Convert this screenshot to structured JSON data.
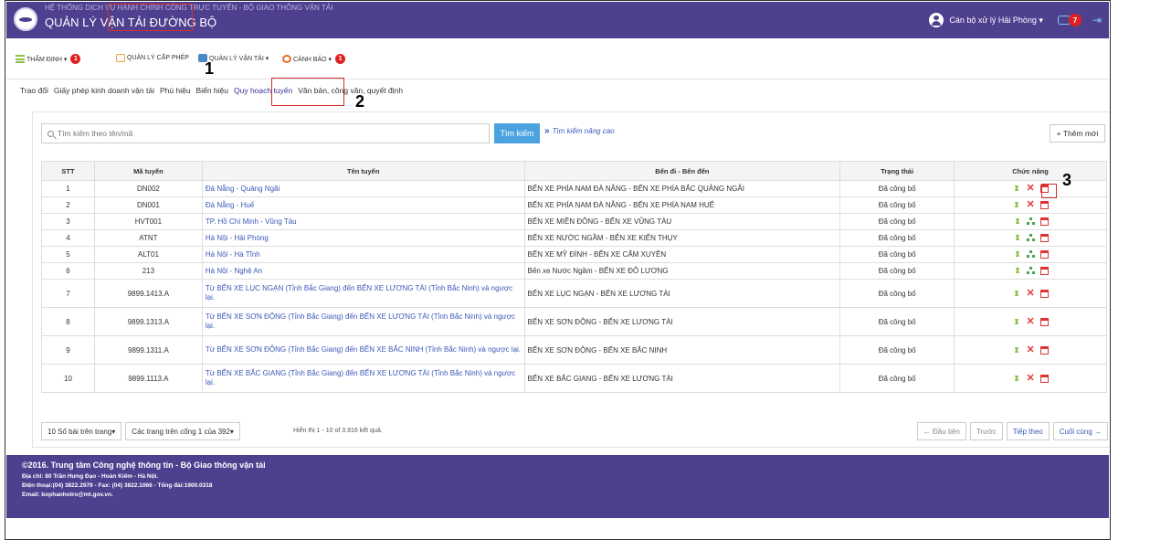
{
  "header": {
    "subtitle": "HỆ THỐNG DỊCH VỤ HÀNH CHÍNH CÔNG TRỰC TUYẾN - BỘ GIAO THÔNG VẬN TẢI",
    "title": "QUẢN LÝ VẬN TẢI ĐƯỜNG BỘ",
    "user": "Cán bộ xử lý Hải Phòng ▾",
    "notif_count": "7"
  },
  "menu": [
    {
      "label": "THẨM ĐỊNH ▾",
      "badge": "1"
    },
    {
      "label": "QUẢN LÝ CẤP PHÉP"
    },
    {
      "label": "QUẢN LÝ VẬN TẢI ▾"
    },
    {
      "label": "CẢNH BÁO ▾",
      "badge": "1"
    }
  ],
  "submenu": [
    "Trao đổi",
    "Giấy phép kinh doanh vận tải",
    "Phù hiệu",
    "Biển hiệu",
    "Quy hoạch tuyến",
    "Văn bản, công văn, quyết định"
  ],
  "annotations": [
    "1",
    "2",
    "3"
  ],
  "search": {
    "placeholder": "Tìm kiếm theo tên/mã",
    "button": "Tìm kiếm",
    "advanced": "Tìm kiếm nâng cao",
    "add_button": "+ Thêm mới"
  },
  "table": {
    "headers": [
      "STT",
      "Mã tuyến",
      "Tên tuyến",
      "Bến đi - Bến đến",
      "Trạng thái",
      "Chức năng"
    ],
    "rows": [
      {
        "stt": "1",
        "code": "DN002",
        "name": "Đà Nẵng - Quảng Ngãi",
        "stations": "BẾN XE PHÍA NAM ĐÀ NẴNG - BẾN XE PHÍA BẮC QUẢNG NGÃI",
        "status": "Đã công bố",
        "actions": [
          "approve",
          "delete",
          "calendar"
        ]
      },
      {
        "stt": "2",
        "code": "DN001",
        "name": "Đà Nẵng - Huế",
        "stations": "BẾN XE PHÍA NAM ĐÀ NẴNG - BẾN XE PHÍA NAM HUẾ",
        "status": "Đã công bố",
        "actions": [
          "approve",
          "delete",
          "calendar"
        ]
      },
      {
        "stt": "3",
        "code": "HVT001",
        "name": "TP. Hồ Chí Minh - Vũng Tàu",
        "stations": "BẾN XE MIỀN ĐÔNG - BẾN XE VŨNG TÀU",
        "status": "Đã công bố",
        "actions": [
          "approve",
          "tree",
          "calendar"
        ]
      },
      {
        "stt": "4",
        "code": "ATNT",
        "name": "Hà Nội - Hải Phòng",
        "stations": "BẾN XE NƯỚC NGẦM - BẾN XE KIẾN THỤY",
        "status": "Đã công bố",
        "actions": [
          "approve",
          "tree",
          "calendar"
        ]
      },
      {
        "stt": "5",
        "code": "ALT01",
        "name": "Hà Nội - Hà Tĩnh",
        "stations": "BẾN XE MỸ ĐÌNH - BẾN XE CẨM XUYÊN",
        "status": "Đã công bố",
        "actions": [
          "approve",
          "tree",
          "calendar"
        ]
      },
      {
        "stt": "6",
        "code": "213",
        "name": "Hà Nội - Nghệ An",
        "stations": "Bến xe Nước Ngầm - BẾN XE ĐÔ LƯƠNG",
        "status": "Đã công bố",
        "actions": [
          "approve",
          "tree",
          "calendar"
        ]
      },
      {
        "stt": "7",
        "code": "9899.1413.A",
        "name": "Từ BẾN XE LỤC NGẠN (Tỉnh Bắc Giang) đến BẾN XE LƯƠNG TÀI (Tỉnh Bắc Ninh) và ngược lại.",
        "stations": "BẾN XE LỤC NGẠN - BẾN XE LƯƠNG TÀI",
        "status": "Đã công bố",
        "actions": [
          "approve",
          "delete",
          "calendar"
        ]
      },
      {
        "stt": "8",
        "code": "9899.1313.A",
        "name": "Từ BẾN XE SƠN ĐỘNG (Tỉnh Bắc Giang) đến BẾN XE LƯƠNG TÀI (Tỉnh Bắc Ninh) và ngược lại.",
        "stations": "BẾN XE SƠN ĐỘNG - BẾN XE LƯƠNG TÀI",
        "status": "Đã công bố",
        "actions": [
          "approve",
          "delete",
          "calendar"
        ]
      },
      {
        "stt": "9",
        "code": "9899.1311.A",
        "name": "Từ BẾN XE SƠN ĐỘNG (Tỉnh Bắc Giang) đến BẾN XE BẮC NINH (Tỉnh Bắc Ninh) và ngược lại.",
        "stations": "BẾN XE SƠN ĐỘNG - BẾN XE BẮC NINH",
        "status": "Đã công bố",
        "actions": [
          "approve",
          "delete",
          "calendar"
        ]
      },
      {
        "stt": "10",
        "code": "9899.1113.A",
        "name": "Từ BẾN XE BẮC GIANG (Tỉnh Bắc Giang) đến BẾN XE LƯƠNG TÀI (Tỉnh Bắc Ninh) và ngược lại.",
        "stations": "BẾN XE BẮC GIANG - BẾN XE LƯƠNG TÀI",
        "status": "Đã công bố",
        "actions": [
          "approve",
          "delete",
          "calendar"
        ]
      }
    ]
  },
  "pagination": {
    "per_page": "10 Số bài trên trang▾",
    "pages": "Các trang trên cổng 1 của 392▾",
    "info": "Hiển thị 1 - 10 of 3.916 kết quả.",
    "first": "← Đầu tiên",
    "prev": "Trước",
    "next": "Tiếp theo",
    "last": "Cuối cùng →"
  },
  "footer": {
    "title": "©2016. Trung tâm Công nghệ thông tin - Bộ Giao thông vận tải",
    "address": "Địa chỉ: 80 Trần Hưng Đạo - Hoàn Kiếm - Hà Nội.",
    "phone": "Điện thoại:(04) 3822.2979 - Fax: (04) 3822.1066 - Tổng đài:1900.0318",
    "email": "Email: bophanhotro@mt.gov.vn."
  },
  "colors": {
    "brand": "#4f3f8f",
    "accent": "#4aa3df",
    "highlight": "#d32f2f"
  }
}
